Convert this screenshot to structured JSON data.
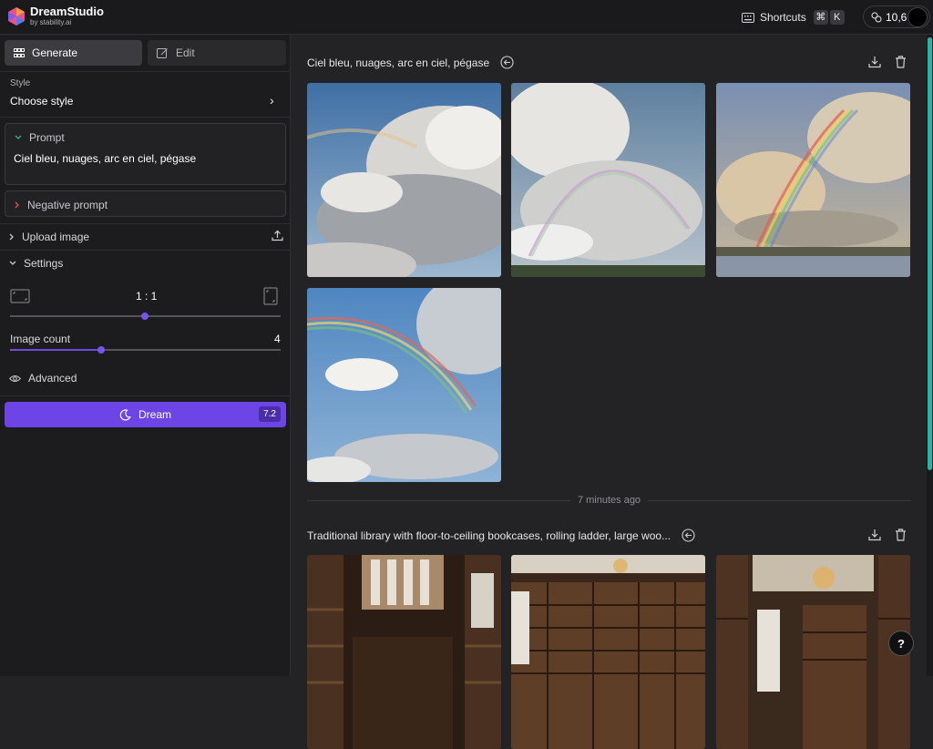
{
  "app": {
    "title": "DreamStudio",
    "subtitle": "by stability.ai"
  },
  "header": {
    "shortcuts_label": "Shortcuts",
    "shortcut_keys": [
      "⌘",
      "K"
    ],
    "credits": "10,6"
  },
  "sidebar": {
    "tabs": [
      {
        "label": "Generate",
        "icon": "grid-icon",
        "active": true
      },
      {
        "label": "Edit",
        "icon": "edit-icon",
        "active": false
      }
    ],
    "style": {
      "label": "Style",
      "value": "Choose style"
    },
    "prompt": {
      "label": "Prompt",
      "value": "Ciel bleu, nuages, arc en ciel, pégase"
    },
    "negative_prompt": {
      "label": "Negative prompt"
    },
    "upload_image": {
      "label": "Upload image"
    },
    "settings": {
      "label": "Settings",
      "aspect_ratio": "1 : 1",
      "aspect_ratio_slider": 0.5,
      "image_count_label": "Image count",
      "image_count": "4",
      "image_count_slider": 0.33,
      "advanced_label": "Advanced"
    },
    "dream": {
      "label": "Dream",
      "cost": "7.2"
    }
  },
  "generations": [
    {
      "prompt": "Ciel bleu, nuages, arc en ciel, pégase",
      "image_count": 4,
      "subject": "sky"
    },
    {
      "time_ago": "7 minutes ago",
      "prompt": "Traditional library with floor-to-ceiling bookcases, rolling ladder, large woo...",
      "image_count": 3,
      "subject": "library"
    }
  ],
  "colors": {
    "accent": "#6d45e6",
    "background": "#232325",
    "sidebar": "#1c1c1e",
    "scrollbar": "#2ab3a8"
  },
  "help_label": "?"
}
